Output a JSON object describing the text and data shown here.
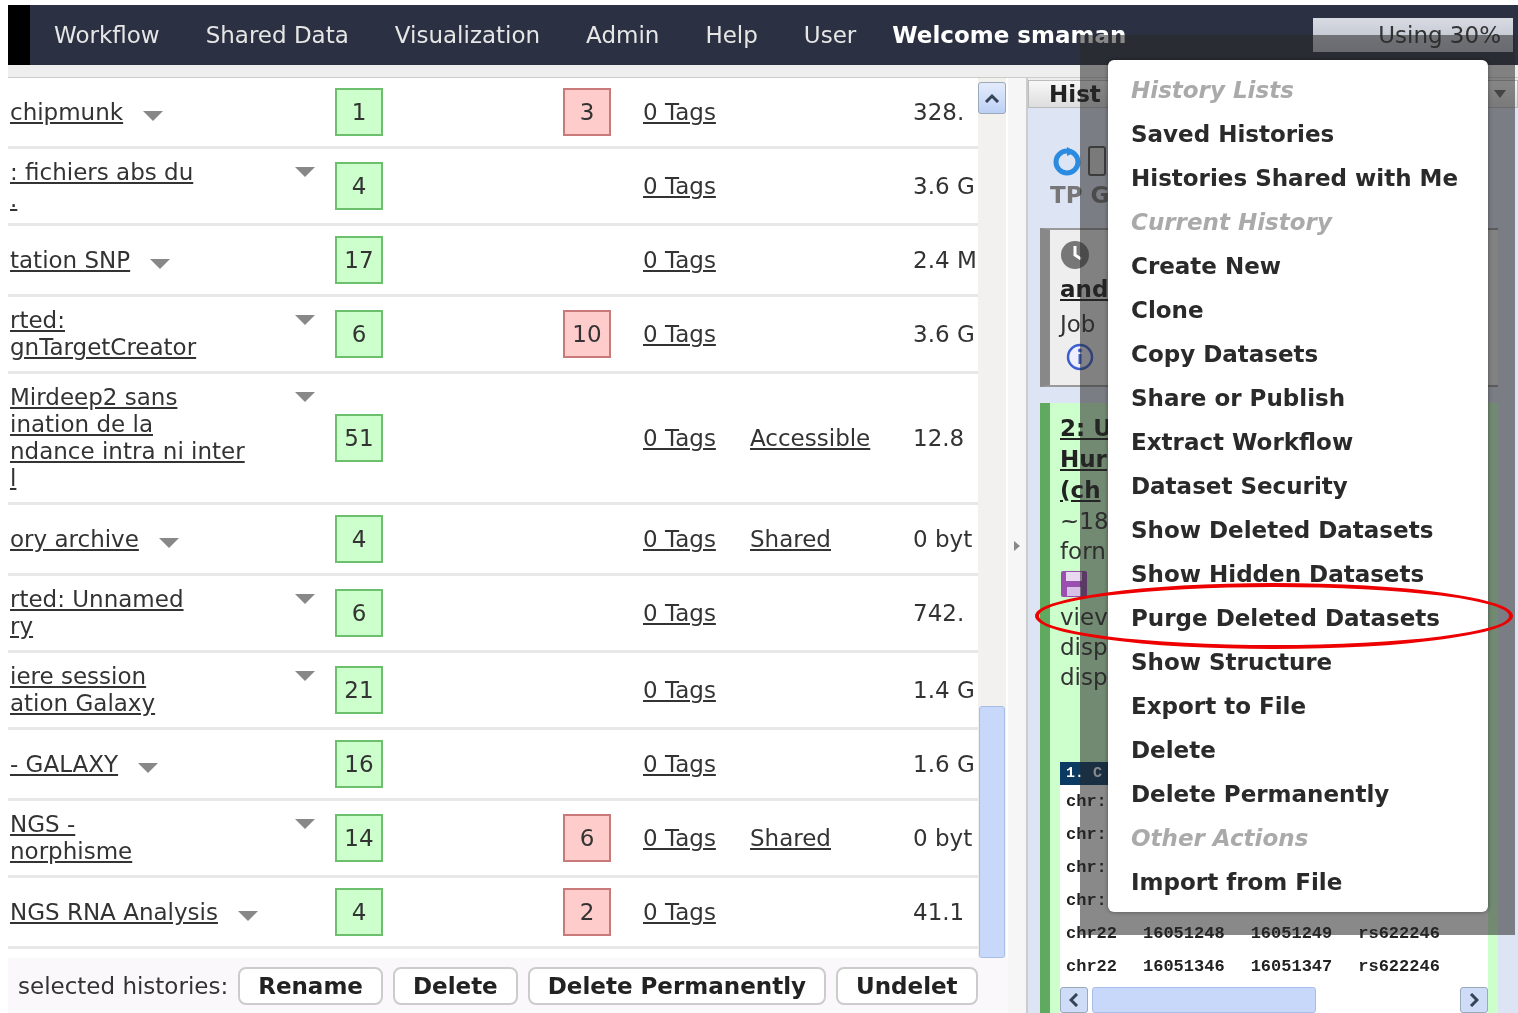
{
  "top_bar": {
    "nav": [
      "Workflow",
      "Shared Data",
      "Visualization",
      "Admin",
      "Help",
      "User"
    ],
    "welcome": "Welcome smaman",
    "usage": "Using 30%"
  },
  "histories": {
    "rows": [
      {
        "name_lines": [
          "chipmunk"
        ],
        "count": "1",
        "deleted": "3",
        "tags": "0 Tags",
        "size": "328."
      },
      {
        "name_lines": [
          ": fichiers abs du",
          "."
        ],
        "count": "4",
        "tags": "0 Tags",
        "size": "3.6 G"
      },
      {
        "name_lines": [
          "tation SNP"
        ],
        "count": "17",
        "tags": "0 Tags",
        "size": "2.4 M"
      },
      {
        "name_lines": [
          "rted:",
          "gnTargetCreator"
        ],
        "count": "6",
        "deleted": "10",
        "tags": "0 Tags",
        "size": "3.6 G"
      },
      {
        "name_lines": [
          "Mirdeep2 sans",
          "ination de la",
          "ndance intra ni inter",
          "l"
        ],
        "count": "51",
        "tags": "0 Tags",
        "sharing": "Accessible",
        "size": "12.8"
      },
      {
        "name_lines": [
          "ory archive"
        ],
        "count": "4",
        "tags": "0 Tags",
        "sharing": "Shared",
        "size": "0 byt"
      },
      {
        "name_lines": [
          "rted: Unnamed",
          "ry"
        ],
        "count": "6",
        "tags": "0 Tags",
        "size": "742."
      },
      {
        "name_lines": [
          "iere session",
          "ation Galaxy"
        ],
        "count": "21",
        "tags": "0 Tags",
        "size": "1.4 G"
      },
      {
        "name_lines": [
          "- GALAXY"
        ],
        "count": "16",
        "tags": "0 Tags",
        "size": "1.6 G"
      },
      {
        "name_lines": [
          "NGS -",
          "norphisme"
        ],
        "count": "14",
        "deleted": "6",
        "tags": "0 Tags",
        "sharing": "Shared",
        "size": "0 byt"
      },
      {
        "name_lines": [
          "NGS RNA Analysis"
        ],
        "count": "4",
        "deleted": "2",
        "tags": "0 Tags",
        "size": "41.1"
      }
    ],
    "actions_label": "selected histories:",
    "actions": [
      "Rename",
      "Delete",
      "Delete Permanently",
      "Undelet"
    ]
  },
  "history_panel": {
    "title": "Hist",
    "name": "TP G",
    "job": {
      "title": "and",
      "state": "Job"
    },
    "dataset": {
      "title_lines": [
        "2: U",
        "Hur",
        "(ch"
      ],
      "info_lines": [
        "~18",
        "forn"
      ],
      "note_lines": [
        "viev",
        "disp",
        "disp"
      ],
      "peek_header": "1. C",
      "peek_rows": [
        [
          "chr:"
        ],
        [
          "chr:"
        ],
        [
          "chr:"
        ],
        [
          "chr:"
        ],
        [
          "chr22",
          "16051248",
          "16051249",
          "rs622246"
        ],
        [
          "chr22",
          "16051346",
          "16051347",
          "rs622246"
        ]
      ]
    }
  },
  "history_menu": {
    "items": [
      {
        "kind": "header",
        "label": "History Lists"
      },
      {
        "kind": "item",
        "label": "Saved Histories",
        "circled": false
      },
      {
        "kind": "item",
        "label": "Histories Shared with Me",
        "circled": false
      },
      {
        "kind": "header",
        "label": "Current History"
      },
      {
        "kind": "item",
        "label": "Create New",
        "circled": false
      },
      {
        "kind": "item",
        "label": "Clone",
        "circled": false
      },
      {
        "kind": "item",
        "label": "Copy Datasets",
        "circled": false
      },
      {
        "kind": "item",
        "label": "Share or Publish",
        "circled": false
      },
      {
        "kind": "item",
        "label": "Extract Workflow",
        "circled": false
      },
      {
        "kind": "item",
        "label": "Dataset Security",
        "circled": false
      },
      {
        "kind": "item",
        "label": "Show Deleted Datasets",
        "circled": false
      },
      {
        "kind": "item",
        "label": "Show Hidden Datasets",
        "circled": false
      },
      {
        "kind": "item",
        "label": "Purge Deleted Datasets",
        "circled": true
      },
      {
        "kind": "item",
        "label": "Show Structure",
        "circled": false
      },
      {
        "kind": "item",
        "label": "Export to File",
        "circled": false
      },
      {
        "kind": "item",
        "label": "Delete",
        "circled": false
      },
      {
        "kind": "item",
        "label": "Delete Permanently",
        "circled": false
      },
      {
        "kind": "header",
        "label": "Other Actions"
      },
      {
        "kind": "item",
        "label": "Import from File",
        "circled": false
      }
    ]
  }
}
